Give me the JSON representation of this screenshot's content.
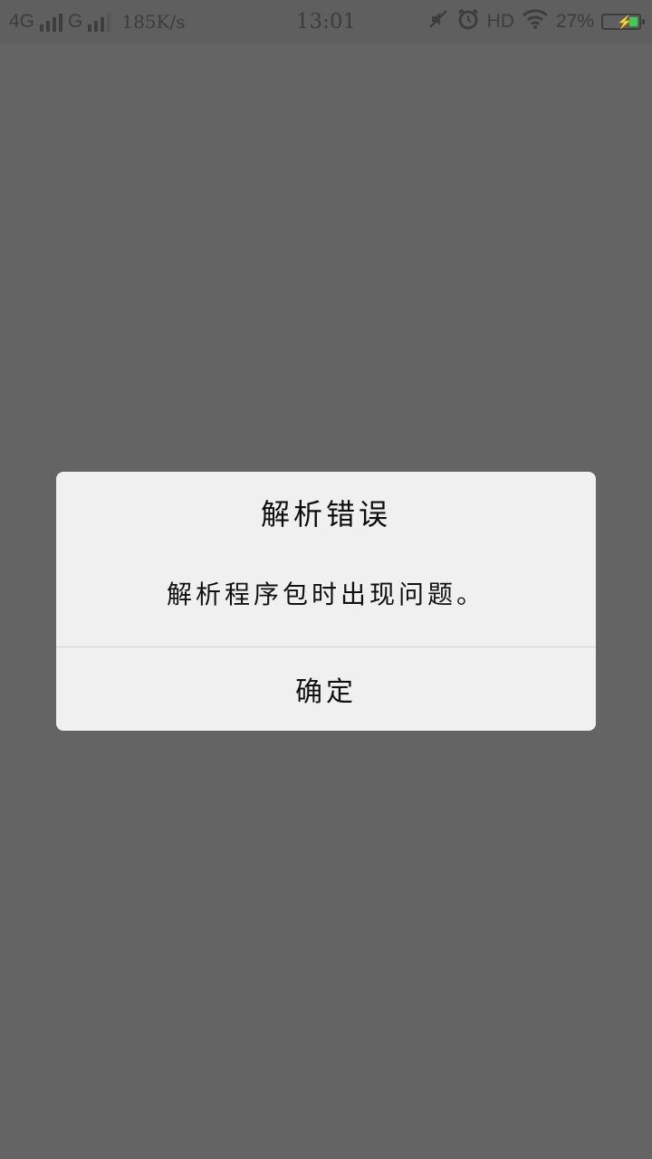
{
  "status_bar": {
    "network_primary": "4G",
    "network_secondary": "G",
    "net_speed": "185K/s",
    "time": "13:01",
    "hd_label": "HD",
    "battery_percent": "27%",
    "battery_level": 0.27,
    "battery_color": "#39d14a",
    "icons": [
      "signal-bars-icon",
      "mute-icon",
      "alarm-icon",
      "wifi-icon",
      "battery-charging-icon"
    ]
  },
  "dialog": {
    "title": "解析错误",
    "message": "解析程序包时出现问题。",
    "confirm_label": "确定"
  },
  "colors": {
    "backdrop": "#646464",
    "dialog_bg": "#f0f0f0",
    "text": "#111111"
  }
}
